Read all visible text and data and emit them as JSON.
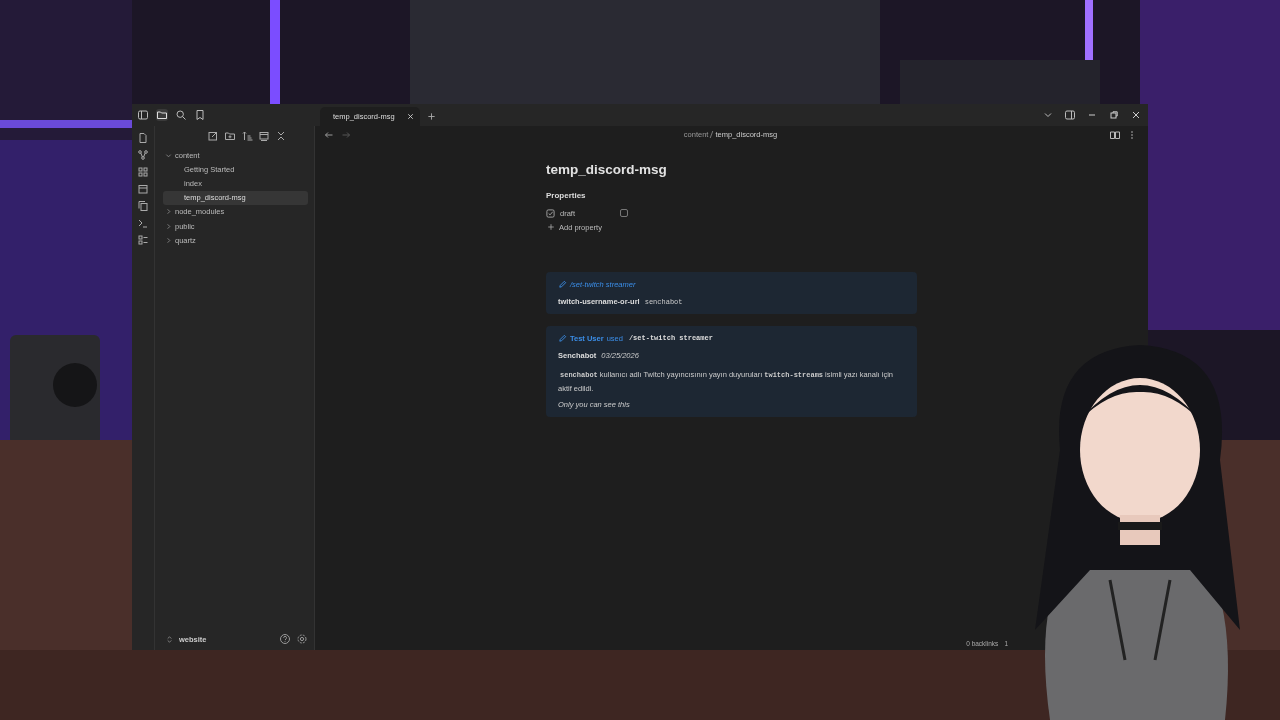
{
  "tabs": [
    {
      "label": "temp_discord-msg",
      "selected": true
    }
  ],
  "file_tree": [
    {
      "label": "content",
      "expanded": true,
      "selected": false,
      "children": [
        {
          "label": "Getting Started",
          "selected": false
        },
        {
          "label": "index",
          "selected": false
        },
        {
          "label": "temp_discord-msg",
          "selected": true
        }
      ]
    },
    {
      "label": "node_modules",
      "expanded": false,
      "selected": false
    },
    {
      "label": "public",
      "expanded": false,
      "selected": false
    },
    {
      "label": "quartz",
      "expanded": false,
      "selected": false
    }
  ],
  "vault": {
    "name": "website"
  },
  "breadcrumb": [
    "content",
    "temp_discord-msg"
  ],
  "note": {
    "title": "temp_discord-msg",
    "properties_heading": "Properties",
    "properties": [
      {
        "name": "draft",
        "checked": false
      }
    ],
    "add_property": "Add property",
    "command_card": {
      "command": "/set-twitch streamer",
      "option": "twitch-username-or-url",
      "value": "senchabot"
    },
    "reply_card": {
      "user": "Test User",
      "verb": "used",
      "command": "/set-twitch streamer",
      "author": "Senchabot",
      "date": "03/25/2026",
      "message": [
        {
          "kind": "code",
          "text": "senchabot"
        },
        {
          "kind": "text",
          "text": "kullanıcı adlı Twitch yayıncısının yayın duyuruları"
        },
        {
          "kind": "code",
          "text": "twitch-streams"
        },
        {
          "kind": "text",
          "text": "isimli yazı kanalı için aktif edildi."
        }
      ],
      "footer": "Only you can see this"
    }
  },
  "status_bar": [
    "0 backlinks",
    "1"
  ]
}
